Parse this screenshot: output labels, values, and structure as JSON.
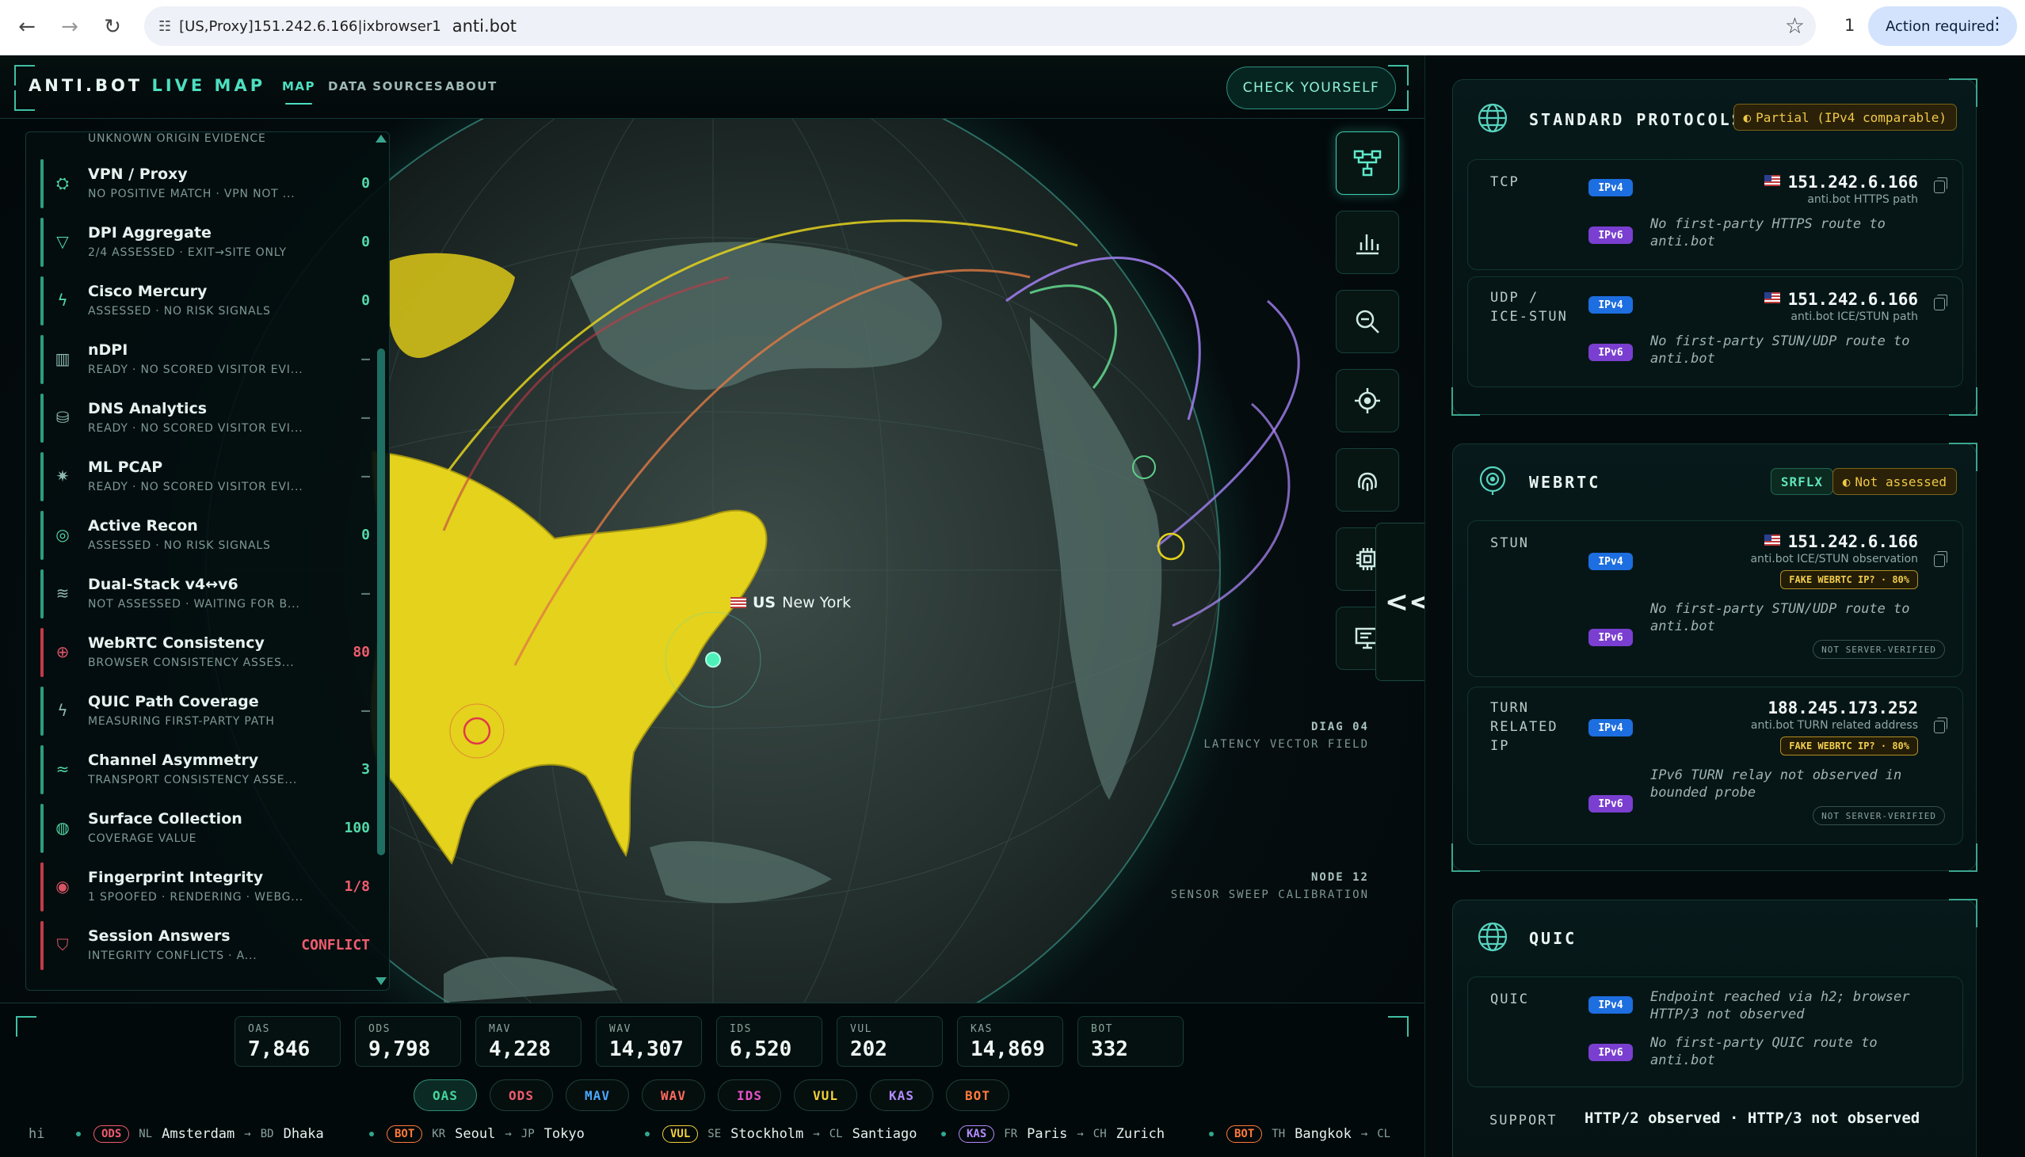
{
  "browser": {
    "proxy_label": "[US,Proxy]151.242.6.166|ixbrowser1",
    "url": "anti.bot",
    "extensions_count": "1",
    "action_required": "Action required"
  },
  "header": {
    "brand_main": "ANTI.BOT",
    "brand_accent": "LIVE MAP",
    "nav": [
      "MAP",
      "DATA SOURCES",
      "ABOUT"
    ],
    "check_button": "CHECK YOURSELF"
  },
  "list": {
    "top_partial_sub": "UNKNOWN ORIGIN EVIDENCE",
    "items": [
      {
        "label": "VPN / Proxy",
        "sub": "NO POSITIVE MATCH · VPN NOT ...",
        "value": "0",
        "tone": "green",
        "icon": "mask-icon"
      },
      {
        "label": "DPI Aggregate",
        "sub": "2/4 ASSESSED · EXIT→SITE ONLY",
        "value": "0",
        "tone": "green",
        "icon": "funnel-icon"
      },
      {
        "label": "Cisco Mercury",
        "sub": "ASSESSED · NO RISK SIGNALS",
        "value": "0",
        "tone": "green",
        "icon": "bolt-icon"
      },
      {
        "label": "nDPI",
        "sub": "READY · NO SCORED VISITOR EVI...",
        "value": "—",
        "tone": "neutral",
        "icon": "bars-icon"
      },
      {
        "label": "DNS Analytics",
        "sub": "READY · NO SCORED VISITOR EVI...",
        "value": "—",
        "tone": "neutral",
        "icon": "database-icon"
      },
      {
        "label": "ML PCAP",
        "sub": "READY · NO SCORED VISITOR EVI...",
        "value": "—",
        "tone": "neutral",
        "icon": "cog-icon"
      },
      {
        "label": "Active Recon",
        "sub": "ASSESSED · NO RISK SIGNALS",
        "value": "0",
        "tone": "green",
        "icon": "target-icon"
      },
      {
        "label": "Dual-Stack v4↔v6",
        "sub": "NOT ASSESSED · WAITING FOR B...",
        "value": "—",
        "tone": "neutral",
        "icon": "layers-icon"
      },
      {
        "label": "WebRTC Consistency",
        "sub": "BROWSER CONSISTENCY ASSES...",
        "value": "80",
        "tone": "red",
        "icon": "globe-icon"
      },
      {
        "label": "QUIC Path Coverage",
        "sub": "MEASURING FIRST-PARTY PATH",
        "value": "—",
        "tone": "neutral",
        "icon": "bolt-icon"
      },
      {
        "label": "Channel Asymmetry",
        "sub": "TRANSPORT CONSISTENCY ASSE...",
        "value": "3",
        "tone": "green",
        "icon": "wave-icon"
      },
      {
        "label": "Surface Collection",
        "sub": "COVERAGE VALUE",
        "value": "100",
        "tone": "green",
        "icon": "bulb-icon"
      },
      {
        "label": "Fingerprint Integrity",
        "sub": "1 SPOOFED · RENDERING · WEBG...",
        "value": "1/8",
        "tone": "red",
        "icon": "fingerprint-icon"
      },
      {
        "label": "Session Answers",
        "sub": "INTEGRITY CONFLICTS · A...",
        "value": "CONFLICT",
        "tone": "red",
        "icon": "shield-icon"
      }
    ]
  },
  "map": {
    "location_flag": "US",
    "location_city": "New York",
    "diag1_title": "DIAG 04",
    "diag1_sub": "LATENCY VECTOR FIELD",
    "diag2_title": "NODE 12",
    "diag2_sub": "SENSOR SWEEP CALIBRATION",
    "collapse_label": "<<"
  },
  "stats": [
    {
      "k": "OAS",
      "v": "7,846"
    },
    {
      "k": "ODS",
      "v": "9,798"
    },
    {
      "k": "MAV",
      "v": "4,228"
    },
    {
      "k": "WAV",
      "v": "14,307"
    },
    {
      "k": "IDS",
      "v": "6,520"
    },
    {
      "k": "VUL",
      "v": "202"
    },
    {
      "k": "KAS",
      "v": "14,869"
    },
    {
      "k": "BOT",
      "v": "332"
    }
  ],
  "chips": [
    {
      "label": "OAS",
      "color": "#45d69c"
    },
    {
      "label": "ODS",
      "color": "#ef5c6e"
    },
    {
      "label": "MAV",
      "color": "#4aa8ff"
    },
    {
      "label": "WAV",
      "color": "#ff6a5e"
    },
    {
      "label": "IDS",
      "color": "#e452c8"
    },
    {
      "label": "VUL",
      "color": "#f2d23c"
    },
    {
      "label": "KAS",
      "color": "#b48cff"
    },
    {
      "label": "BOT",
      "color": "#ff7a3c"
    }
  ],
  "ticker": {
    "lead": "hi",
    "items": [
      {
        "tag": "ODS",
        "color": "#ef5c6e",
        "from_cc": "NL",
        "from": "Amsterdam",
        "to_cc": "BD",
        "to": "Dhaka"
      },
      {
        "tag": "BOT",
        "color": "#ff7a3c",
        "from_cc": "KR",
        "from": "Seoul",
        "to_cc": "JP",
        "to": "Tokyo"
      },
      {
        "tag": "VUL",
        "color": "#f2d23c",
        "from_cc": "SE",
        "from": "Stockholm",
        "to_cc": "CL",
        "to": "Santiago"
      },
      {
        "tag": "KAS",
        "color": "#b48cff",
        "from_cc": "FR",
        "from": "Paris",
        "to_cc": "CH",
        "to": "Zurich"
      },
      {
        "tag": "BOT",
        "color": "#ff7a3c",
        "from_cc": "TH",
        "from": "Bangkok",
        "to_cc": "CL",
        "to": ""
      }
    ]
  },
  "side": {
    "standard": {
      "title": "STANDARD PROTOCOLS",
      "badge": "Partial (IPv4 comparable)",
      "tcp": {
        "label": "TCP",
        "v4": "IPv4",
        "v6": "IPv6",
        "ip": "151.242.6.166",
        "ip_sub": "anti.bot HTTPS path",
        "note": "No first-party HTTPS route to anti.bot"
      },
      "udp": {
        "label": "UDP / ICE-STUN",
        "v4": "IPv4",
        "v6": "IPv6",
        "ip": "151.242.6.166",
        "ip_sub": "anti.bot ICE/STUN path",
        "note": "No first-party STUN/UDP route to anti.bot"
      }
    },
    "webrtc": {
      "title": "WEBRTC",
      "badge_srflx": "SRFLX",
      "badge_status": "Not assessed",
      "stun": {
        "label": "STUN",
        "v4": "IPv4",
        "v6": "IPv6",
        "ip": "151.242.6.166",
        "ip_sub": "anti.bot ICE/STUN observation",
        "fake": "FAKE WEBRTC IP? · 80%",
        "note": "No first-party STUN/UDP route to anti.bot",
        "nsv": "NOT SERVER-VERIFIED"
      },
      "turn": {
        "label": "TURN RELATED IP",
        "v4": "IPv4",
        "v6": "IPv6",
        "ip": "188.245.173.252",
        "ip_sub": "anti.bot TURN related address",
        "fake": "FAKE WEBRTC IP? · 80%",
        "note": "IPv6 TURN relay not observed in bounded probe",
        "nsv": "NOT SERVER-VERIFIED"
      }
    },
    "quic": {
      "title": "QUIC",
      "row": {
        "label": "QUIC",
        "v4": "IPv4",
        "v6": "IPv6",
        "note_v4": "Endpoint reached via h2; browser HTTP/3 not observed",
        "note_v6": "No first-party QUIC route to anti.bot"
      },
      "support_label": "SUPPORT",
      "support_value": "HTTP/2 observed · HTTP/3 not observed"
    }
  }
}
